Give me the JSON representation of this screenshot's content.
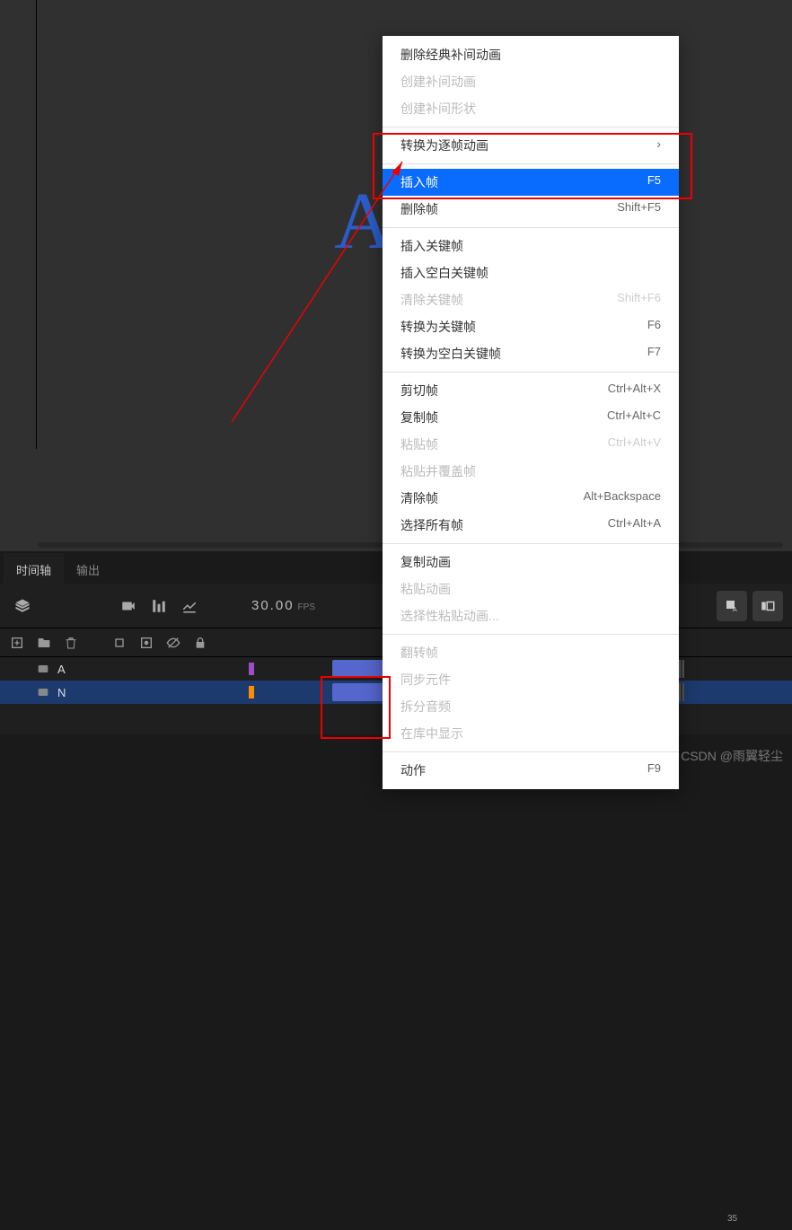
{
  "stage": {
    "letter": "A"
  },
  "panel": {
    "tabs": {
      "timeline": "时间轴",
      "output": "输出"
    },
    "fps_value": "30.00",
    "fps_unit": "FPS"
  },
  "ruler": {
    "t35": "35"
  },
  "layers": [
    {
      "name": "A",
      "dot_color": "purple"
    },
    {
      "name": "N",
      "dot_color": "orange"
    }
  ],
  "menu": {
    "delete_classic_tween": "删除经典补间动画",
    "create_tween": "创建补间动画",
    "create_shape_tween": "创建补间形状",
    "convert_frame_by_frame": "转换为逐帧动画",
    "insert_frame": "插入帧",
    "insert_frame_key": "F5",
    "delete_frame": "删除帧",
    "delete_frame_key": "Shift+F5",
    "insert_keyframe": "插入关键帧",
    "insert_blank_keyframe": "插入空白关键帧",
    "clear_keyframe": "清除关键帧",
    "clear_keyframe_key": "Shift+F6",
    "convert_keyframe": "转换为关键帧",
    "convert_keyframe_key": "F6",
    "convert_blank_keyframe": "转换为空白关键帧",
    "convert_blank_keyframe_key": "F7",
    "cut_frames": "剪切帧",
    "cut_frames_key": "Ctrl+Alt+X",
    "copy_frames": "复制帧",
    "copy_frames_key": "Ctrl+Alt+C",
    "paste_frames": "粘贴帧",
    "paste_frames_key": "Ctrl+Alt+V",
    "paste_overwrite": "粘贴并覆盖帧",
    "clear_frames": "清除帧",
    "clear_frames_key": "Alt+Backspace",
    "select_all_frames": "选择所有帧",
    "select_all_frames_key": "Ctrl+Alt+A",
    "copy_motion": "复制动画",
    "paste_motion": "粘贴动画",
    "paste_motion_special": "选择性粘贴动画...",
    "reverse_frames": "翻转帧",
    "sync_symbols": "同步元件",
    "split_audio": "拆分音频",
    "show_in_library": "在库中显示",
    "actions": "动作",
    "actions_key": "F9"
  },
  "watermark": "CSDN @雨翼轻尘"
}
